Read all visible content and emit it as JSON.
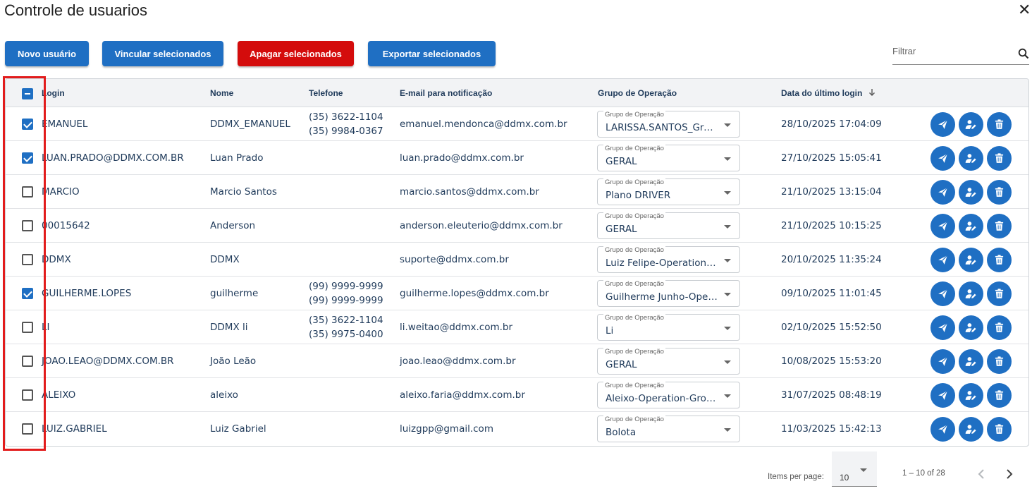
{
  "header": {
    "title": "Controle de usuarios",
    "close_glyph": "✕"
  },
  "toolbar": {
    "new_user": "Novo usuário",
    "link_selected": "Vincular selecionados",
    "delete_selected": "Apagar selecionados",
    "export_selected": "Exportar selecionados"
  },
  "filter": {
    "placeholder": "Filtrar"
  },
  "table": {
    "columns": {
      "login": "Login",
      "nome": "Nome",
      "telefone": "Telefone",
      "email": "E-mail para notificação",
      "grupo": "Grupo de Operação",
      "data": "Data do último login"
    },
    "group_field_label": "Grupo de Operação",
    "rows": [
      {
        "checked": true,
        "login": "EMANUEL",
        "nome": "DDMX_EMANUEL",
        "phones": [
          "(35) 3622-1104",
          "(35) 9984-0367"
        ],
        "email": "emanuel.mendonca@ddmx.com.br",
        "grupo": "LARISSA.SANTOS_Group",
        "data": "28/10/2025 17:04:09"
      },
      {
        "checked": true,
        "login": "LUAN.PRADO@DDMX.COM.BR",
        "nome": "Luan Prado",
        "phones": [],
        "email": "luan.prado@ddmx.com.br",
        "grupo": "GERAL",
        "data": "27/10/2025 15:05:41"
      },
      {
        "checked": false,
        "login": "MARCIO",
        "nome": "Marcio Santos",
        "phones": [],
        "email": "marcio.santos@ddmx.com.br",
        "grupo": "Plano DRIVER",
        "data": "21/10/2025 13:15:04"
      },
      {
        "checked": false,
        "login": "00015642",
        "nome": "Anderson",
        "phones": [],
        "email": "anderson.eleuterio@ddmx.com.br",
        "grupo": "GERAL",
        "data": "21/10/2025 10:15:25"
      },
      {
        "checked": false,
        "login": "DDMX",
        "nome": "DDMX",
        "phones": [],
        "email": "suporte@ddmx.com.br",
        "grupo": "Luiz Felipe-Operation-Group",
        "data": "20/10/2025 11:35:24"
      },
      {
        "checked": true,
        "login": "GUILHERME.LOPES",
        "nome": "guilherme",
        "phones": [
          "(99) 9999-9999",
          "(99) 9999-9999"
        ],
        "email": "guilherme.lopes@ddmx.com.br",
        "grupo": "Guilherme Junho-Operation",
        "data": "09/10/2025 11:01:45"
      },
      {
        "checked": false,
        "login": "LI",
        "nome": "DDMX li",
        "phones": [
          "(35) 3622-1104",
          "(35) 9975-0400"
        ],
        "email": "li.weitao@ddmx.com.br",
        "grupo": "Li",
        "data": "02/10/2025 15:52:50"
      },
      {
        "checked": false,
        "login": "JOAO.LEAO@DDMX.COM.BR",
        "nome": "João Leão",
        "phones": [],
        "email": "joao.leao@ddmx.com.br",
        "grupo": "GERAL",
        "data": "10/08/2025 15:53:20"
      },
      {
        "checked": false,
        "login": "ALEIXO",
        "nome": "aleixo",
        "phones": [],
        "email": "aleixo.faria@ddmx.com.br",
        "grupo": "Aleixo-Operation-Group",
        "data": "31/07/2025 08:48:19"
      },
      {
        "checked": false,
        "login": "LUIZ.GABRIEL",
        "nome": "Luiz Gabriel",
        "phones": [],
        "email": "luizgpp@gmail.com",
        "grupo": "Bolota",
        "data": "11/03/2025 15:42:13"
      }
    ]
  },
  "pagination": {
    "items_per_page_label": "Items per page:",
    "page_size": "10",
    "range": "1 – 10 of 28"
  },
  "colors": {
    "primary": "#1f6fc3",
    "danger": "#d40c0c",
    "highlight": "#e21c1c",
    "text": "#1f3a5a"
  },
  "icons": {
    "row_actions": [
      "send-icon",
      "edit-user-icon",
      "trash-icon"
    ]
  }
}
